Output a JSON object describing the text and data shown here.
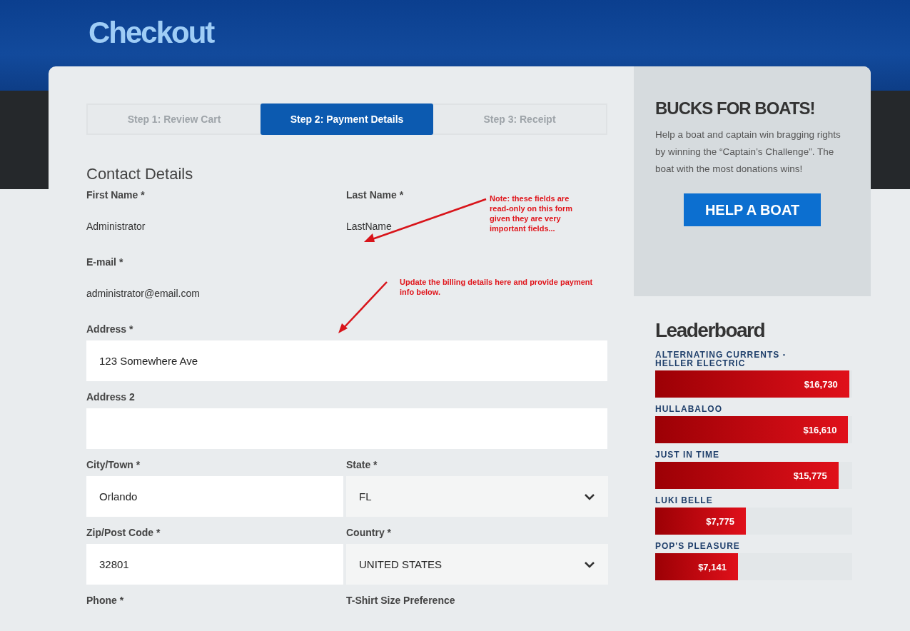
{
  "page_title": "Checkout",
  "steps": [
    {
      "label": "Step 1: Review Cart",
      "selected": false
    },
    {
      "label": "Step 2: Payment Details",
      "selected": true
    },
    {
      "label": "Step 3: Receipt",
      "selected": false
    }
  ],
  "section_title": "Contact Details",
  "rows": [
    [
      {
        "kind": "readonly",
        "label": "First Name *",
        "value": "Administrator"
      },
      {
        "kind": "readonly",
        "label": "Last Name *",
        "value": "LastName"
      }
    ],
    [
      {
        "kind": "readonly",
        "label": "E-mail *",
        "value": "administrator@email.com"
      }
    ],
    [
      {
        "kind": "input",
        "label": "Address *",
        "value": "123 Somewhere Ave"
      }
    ],
    [
      {
        "kind": "input",
        "label": "Address 2"
      }
    ],
    [
      {
        "kind": "input",
        "label": "City/Town *",
        "value": "Orlando"
      },
      {
        "kind": "select",
        "label": "State *",
        "value": "FL"
      }
    ],
    [
      {
        "kind": "input",
        "label": "Zip/Post Code *",
        "value": "32801"
      },
      {
        "kind": "select",
        "label": "Country *",
        "value": "UNITED STATES"
      }
    ],
    [
      {
        "kind": "label",
        "label": "Phone *"
      },
      {
        "kind": "label",
        "label": "T-Shirt Size Preference"
      }
    ]
  ],
  "annotations": [
    "Note: these fields are read-only on this form given they are very important fields...",
    "Update the billing details here and provide payment info below."
  ],
  "promo": {
    "title": "BUCKS FOR BOATS!",
    "text": "Help a boat and captain win bragging rights by winning the “Captain’s Challenge”. The boat with the most donations wins!",
    "button": "HELP A BOAT"
  },
  "leaderboard": {
    "title": "Leaderboard",
    "entries": [
      {
        "name": "ALTERNATING CURRENTS - HELLER ELECTRIC",
        "amount": "$16,730",
        "level": 0.985
      },
      {
        "name": "HULLABALOO",
        "amount": "$16,610",
        "level": 0.98
      },
      {
        "name": "JUST IN TIME",
        "amount": "$15,775",
        "level": 0.93
      },
      {
        "name": "LUKI BELLE",
        "amount": "$7,775",
        "level": 0.46
      },
      {
        "name": "POP'S PLEASURE",
        "amount": "$7,141",
        "level": 0.42
      }
    ]
  }
}
